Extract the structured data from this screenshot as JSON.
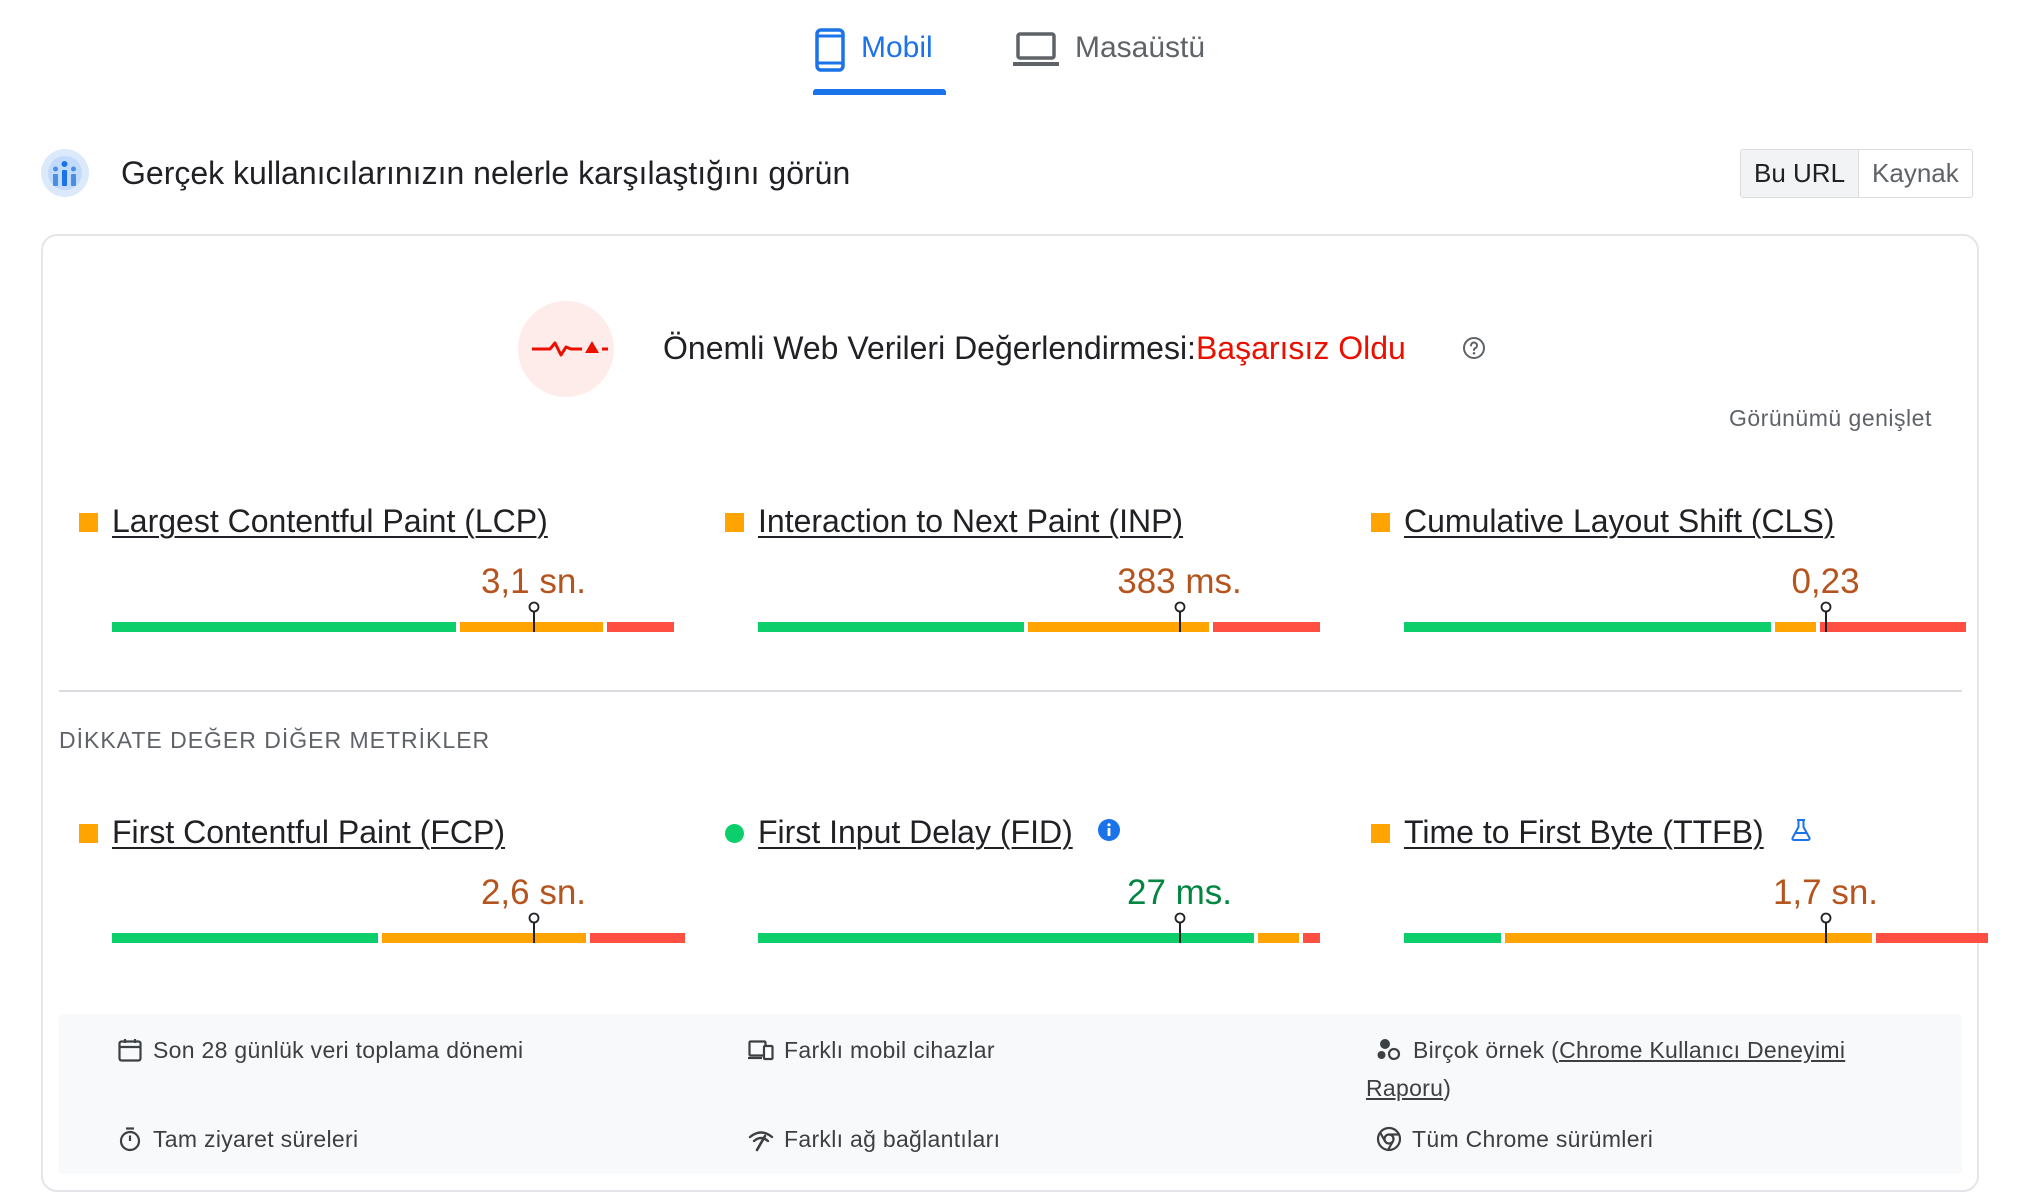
{
  "tabs": [
    {
      "label": "Mobil",
      "icon": "smartphone-icon",
      "active": true
    },
    {
      "label": "Masaüstü",
      "icon": "laptop-icon",
      "active": false
    }
  ],
  "header": {
    "title": "Gerçek kullanıcılarınızın nelerle karşılaştığını görün",
    "toggle": [
      "Bu URL",
      "Kaynak"
    ]
  },
  "assessment": {
    "title": "Önemli Web Verileri Değerlendirmesi:",
    "status": "Başarısız Oldu",
    "expand": "Görünümü genişlet",
    "status_color": "#eb0f00"
  },
  "section_label": "DİKKATE DEĞER DİĞER METRİKLER",
  "metrics": [
    {
      "name": "Largest Contentful Paint (LCP)",
      "value": "3,1 sn.",
      "rating": "needs-improvement",
      "segments": [
        0.62,
        0.26,
        0.12
      ],
      "marker": 0.75
    },
    {
      "name": "Interaction to Next Paint (INP)",
      "value": "383 ms.",
      "rating": "needs-improvement",
      "segments": [
        0.48,
        0.33,
        0.19
      ],
      "marker": 0.75
    },
    {
      "name": "Cumulative Layout Shift (CLS)",
      "value": "0,23",
      "rating": "needs-improvement",
      "segments": [
        0.66,
        0.08,
        0.26
      ],
      "marker": 0.75
    },
    {
      "name": "First Contentful Paint (FCP)",
      "value": "2,6 sn.",
      "rating": "needs-improvement",
      "segments": [
        0.48,
        0.37,
        0.17
      ],
      "marker": 0.75
    },
    {
      "name": "First Input Delay (FID)",
      "value": "27 ms.",
      "rating": "good",
      "segments": [
        0.89,
        0.08,
        0.03
      ],
      "marker": 0.75
    },
    {
      "name": "Time to First Byte (TTFB)",
      "value": "1,7 sn.",
      "rating": "needs-improvement",
      "segments": [
        0.18,
        0.66,
        0.2
      ],
      "marker": 0.75
    }
  ],
  "info": {
    "period": "Son 28 günlük veri toplama dönemi",
    "devices": "Farklı mobil cihazlar",
    "samples_prefix": "Birçok örnek (",
    "samples_link": "Chrome Kullanıcı Deneyimi",
    "samples_link2": "Raporu",
    "samples_suffix": ")",
    "durations": "Tam ziyaret süreleri",
    "networks": "Farklı ağ bağlantıları",
    "chrome": "Tüm Chrome sürümleri"
  },
  "colors": {
    "good": "#0cce6b",
    "needs_improvement": "#ffa400",
    "poor": "#ff4e42",
    "accent": "#1a73e8"
  }
}
